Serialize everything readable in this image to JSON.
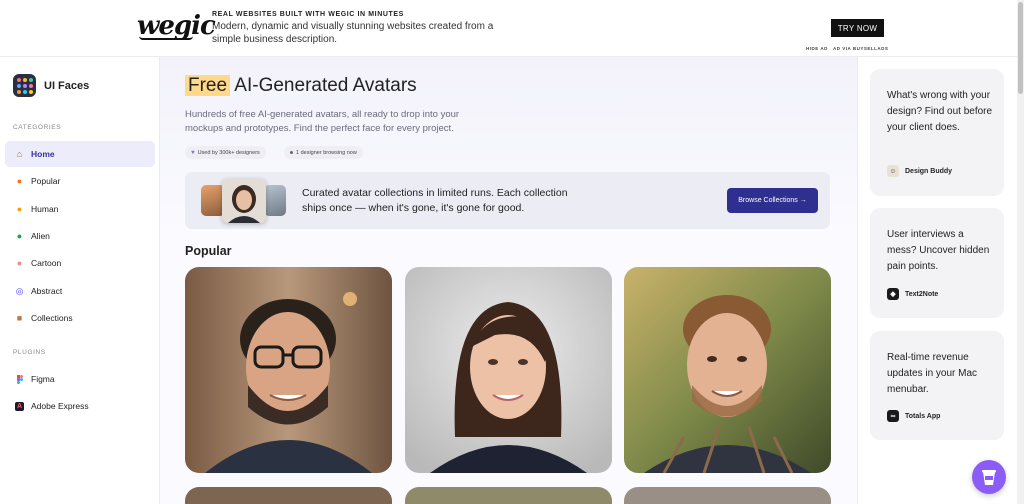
{
  "ad_banner": {
    "logo": "wegic",
    "headline": "REAL WEBSITES BUILT WITH WEGIC IN MINUTES",
    "description": "Modern, dynamic and visually stunning websites created from a simple business description.",
    "cta": "TRY NOW",
    "hide_ad": "HIDE AD",
    "ad_via": "AD VIA BUYSELLADS"
  },
  "sidebar": {
    "brand": "UI Faces",
    "categories_label": "CATEGORIES",
    "categories": [
      {
        "label": "Home",
        "icon": "house-icon",
        "active": true
      },
      {
        "label": "Popular",
        "icon": "fire-icon"
      },
      {
        "label": "Human",
        "icon": "person-icon"
      },
      {
        "label": "Alien",
        "icon": "alien-icon"
      },
      {
        "label": "Cartoon",
        "icon": "cartoon-icon"
      },
      {
        "label": "Abstract",
        "icon": "spiral-icon"
      },
      {
        "label": "Collections",
        "icon": "box-icon"
      }
    ],
    "plugins_label": "PLUGINS",
    "plugins": [
      {
        "label": "Figma",
        "icon": "figma-icon"
      },
      {
        "label": "Adobe Express",
        "icon": "adobe-express-icon"
      }
    ]
  },
  "hero": {
    "title_highlight": "Free",
    "title_rest": " AI-Generated Avatars",
    "subtitle": "Hundreds of free AI-generated avatars, all ready to drop into your mockups and prototypes. Find the perfect face for every project.",
    "badge_designers": "Used by 300k+ designers",
    "badge_browsing": "1 designer browsing now"
  },
  "promo": {
    "text": "Curated avatar collections in limited runs. Each collection ships once — when it's gone, it's gone for good.",
    "button": "Browse Collections →"
  },
  "popular": {
    "title": "Popular"
  },
  "rail": {
    "ads": [
      {
        "text": "What's wrong with your design? Find out before your client does.",
        "brand": "Design Buddy"
      },
      {
        "text": "User interviews a mess? Uncover hidden pain points.",
        "brand": "Text2Note"
      },
      {
        "text": "Real-time revenue updates in your Mac menubar.",
        "brand": "Totals App"
      }
    ]
  },
  "colors": {
    "accent": "#3730a3",
    "highlight": "#ffd88a",
    "button": "#2f2f8f",
    "fab": "#8b5cf6"
  }
}
